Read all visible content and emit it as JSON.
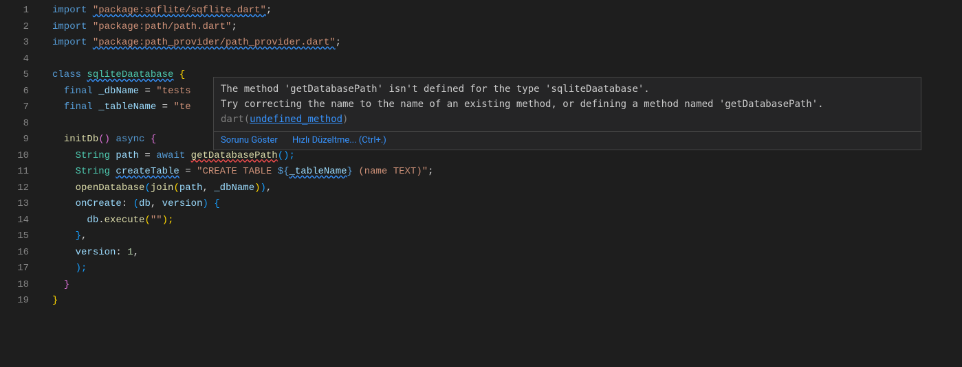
{
  "lines": [
    {
      "num": "1"
    },
    {
      "num": "2"
    },
    {
      "num": "3"
    },
    {
      "num": "4"
    },
    {
      "num": "5"
    },
    {
      "num": "6"
    },
    {
      "num": "7"
    },
    {
      "num": "8"
    },
    {
      "num": "9"
    },
    {
      "num": "10"
    },
    {
      "num": "11"
    },
    {
      "num": "12"
    },
    {
      "num": "13"
    },
    {
      "num": "14"
    },
    {
      "num": "15"
    },
    {
      "num": "16"
    },
    {
      "num": "17"
    },
    {
      "num": "18"
    },
    {
      "num": "19"
    }
  ],
  "code": {
    "l1_kw": "import ",
    "l1_str": "\"package:sqflite/sqflite.dart\"",
    "l1_sc": ";",
    "l2_kw": "import ",
    "l2_str": "\"package:path/path.dart\"",
    "l2_sc": ";",
    "l3_kw": "import ",
    "l3_str": "\"package:path_provider/path_provider.dart\"",
    "l3_sc": ";",
    "l5_kw": "class ",
    "l5_name": "sqliteDaatabase",
    "l5_br": " {",
    "l6_pad": "  ",
    "l6_kw": "final ",
    "l6_var": "_dbName",
    "l6_eq": " = ",
    "l6_str": "\"tests",
    "l7_pad": "  ",
    "l7_kw": "final ",
    "l7_var": "_tableName",
    "l7_eq": " = ",
    "l7_str": "\"te",
    "l9_pad": "  ",
    "l9_fn": "initDb",
    "l9_paren": "() ",
    "l9_async": "async",
    "l9_br": " {",
    "l10_pad": "    ",
    "l10_type": "String ",
    "l10_var": "path",
    "l10_eq": " = ",
    "l10_kw": "await ",
    "l10_fn": "getDatabasePath",
    "l10_paren": "();",
    "l11_pad": "    ",
    "l11_type": "String ",
    "l11_var": "createTable",
    "l11_eq": " = ",
    "l11_str1": "\"CREATE TABLE ",
    "l11_interp_open": "${",
    "l11_interp_var": "_tableName",
    "l11_interp_close": "}",
    "l11_str2": " (name TEXT)\"",
    "l11_sc": ";",
    "l12_pad": "    ",
    "l12_fn1": "openDatabase",
    "l12_p1": "(",
    "l12_fn2": "join",
    "l12_p2": "(",
    "l12_v1": "path",
    "l12_comma": ", ",
    "l12_v2": "_dbName",
    "l12_p3": ")",
    "l12_p4": ")",
    "l12_comma2": ",",
    "l13_pad": "    ",
    "l13_prop": "onCreate",
    "l13_col": ": ",
    "l13_p1": "(",
    "l13_v1": "db",
    "l13_comma": ", ",
    "l13_v2": "version",
    "l13_p2": ") ",
    "l13_br": "{",
    "l14_pad": "      ",
    "l14_obj": "db",
    "l14_dot": ".",
    "l14_fn": "execute",
    "l14_p": "(",
    "l14_str": "\"\"",
    "l14_p2": ");",
    "l15_pad": "    ",
    "l15_br": "}",
    "l15_comma": ",",
    "l16_pad": "    ",
    "l16_prop": "version",
    "l16_col": ": ",
    "l16_num": "1",
    "l16_comma": ",",
    "l17_pad": "    ",
    "l17_p": ");",
    "l18_pad": "  ",
    "l18_br": "}",
    "l19_br": "}"
  },
  "hover": {
    "msg_line1": "The method 'getDatabasePath' isn't defined for the type 'sqliteDaatabase'.",
    "msg_line2": "Try correcting the name to the name of an existing method, or defining a method named 'getDatabasePath'. ",
    "source_prefix": "dart",
    "paren_open": "(",
    "link": "undefined_method",
    "paren_close": ")",
    "action_show": "Sorunu Göster",
    "action_fix": "Hızlı Düzeltme... (Ctrl+.)"
  }
}
